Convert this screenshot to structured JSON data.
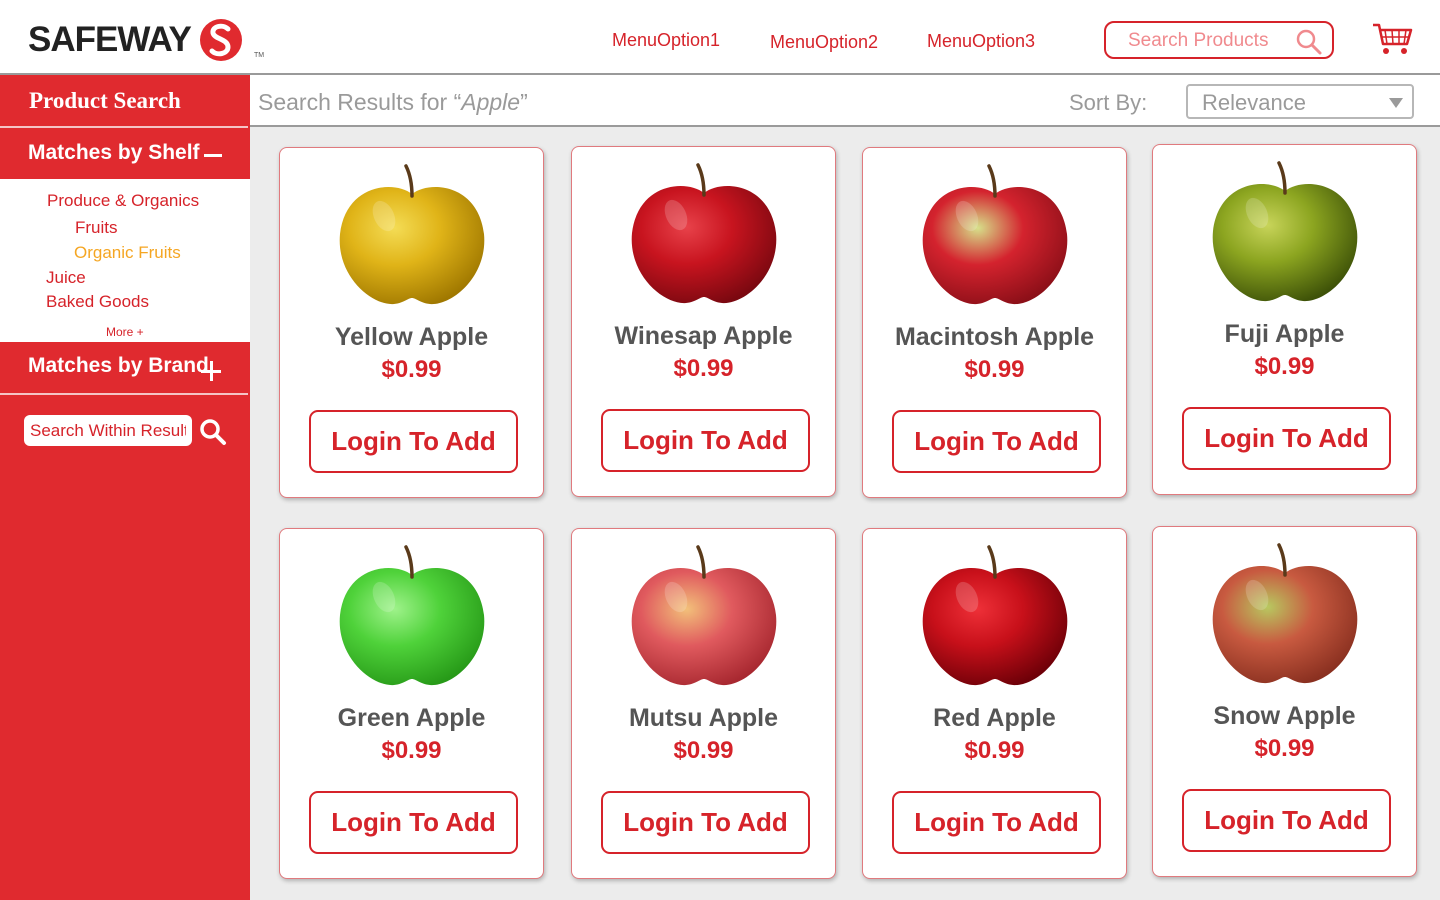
{
  "header": {
    "logo_text": "SAFEWAY",
    "logo_tm": "TM",
    "menu": [
      "MenuOption1",
      "MenuOption2",
      "MenuOption3"
    ],
    "search_placeholder": "Search Products",
    "search_icon": "magnifier-icon",
    "cart_icon": "shopping-cart-icon",
    "brand_color": "#d6232a"
  },
  "sidebar": {
    "title": "Product Search",
    "shelf_label": "Matches by Shelf",
    "shelf_toggle": "minus",
    "shelf_items": [
      "Produce & Organics",
      "Fruits",
      "Organic Fruits",
      "Juice",
      "Baked Goods"
    ],
    "selected_shelf": "Organic Fruits",
    "selected_color": "#f5a623",
    "more_label": "More +",
    "brand_label": "Matches by Brand",
    "brand_toggle": "plus",
    "within_placeholder": "Search Within Results",
    "bg_color": "#e02a2f"
  },
  "results": {
    "prefix": "Search Results for “",
    "query": "Apple",
    "suffix": "”",
    "sort_label": "Sort By:",
    "sort_value": "Relevance"
  },
  "products": [
    {
      "name": "Yellow Apple",
      "price": "$0.99",
      "button": "Login To Add",
      "skin": "#e0b418",
      "shade": "#a07800",
      "light": "#f4dc55"
    },
    {
      "name": "Winesap Apple",
      "price": "$0.99",
      "button": "Login To Add",
      "skin": "#c8141f",
      "shade": "#7a0810",
      "light": "#e8424a"
    },
    {
      "name": "Macintosh Apple",
      "price": "$0.99",
      "button": "Login To Add",
      "skin": "#d4232e",
      "shade": "#8c0f18",
      "light": "#d6e08a"
    },
    {
      "name": "Fuji Apple",
      "price": "$0.99",
      "button": "Login To Add",
      "skin": "#8ca520",
      "shade": "#3e5208",
      "light": "#c8d45a"
    },
    {
      "name": "Green Apple",
      "price": "$0.99",
      "button": "Login To Add",
      "skin": "#4fd23a",
      "shade": "#279a18",
      "light": "#9ef28a"
    },
    {
      "name": "Mutsu Apple",
      "price": "$0.99",
      "button": "Login To Add",
      "skin": "#e05a5e",
      "shade": "#a82830",
      "light": "#f2c07a"
    },
    {
      "name": "Red Apple",
      "price": "$0.99",
      "button": "Login To Add",
      "skin": "#c8101a",
      "shade": "#6e0008",
      "light": "#ee3038"
    },
    {
      "name": "Snow Apple",
      "price": "$0.99",
      "button": "Login To Add",
      "skin": "#c85a40",
      "shade": "#8a3020",
      "light": "#b8c860"
    }
  ]
}
